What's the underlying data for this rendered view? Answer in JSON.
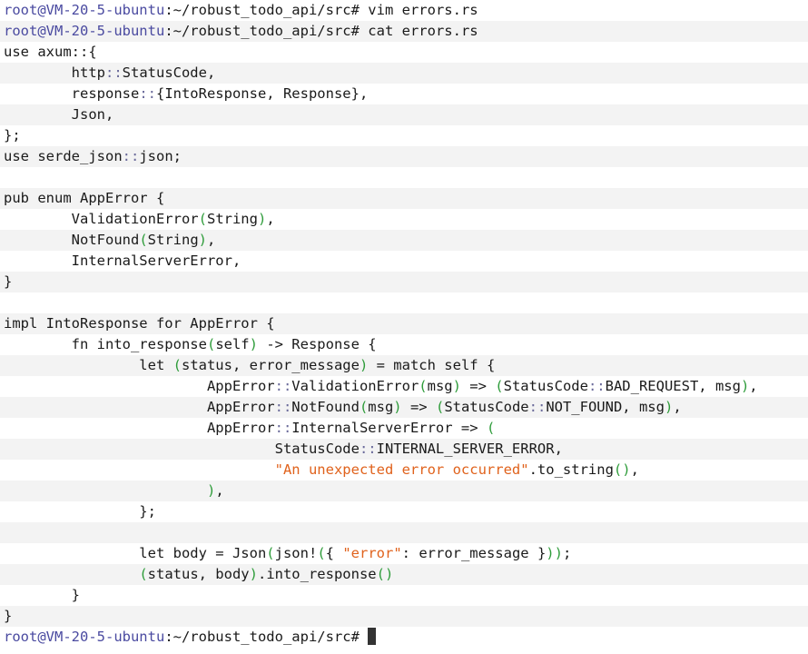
{
  "terminal": {
    "prompt": "root@VM-20-5-ubuntu",
    "cwd": ":~/robust_todo_api/src#",
    "commands": [
      "vim errors.rs",
      "cat errors.rs"
    ],
    "source_lines": [
      [
        {
          "t": "use axum::{",
          "c": "plain"
        }
      ],
      [
        {
          "t": "        http",
          "c": "plain"
        },
        {
          "t": "::",
          "c": "sym"
        },
        {
          "t": "StatusCode,",
          "c": "plain"
        }
      ],
      [
        {
          "t": "        response",
          "c": "plain"
        },
        {
          "t": "::",
          "c": "sym"
        },
        {
          "t": "{IntoResponse, Response},",
          "c": "plain"
        }
      ],
      [
        {
          "t": "        Json,",
          "c": "plain"
        }
      ],
      [
        {
          "t": "};",
          "c": "plain"
        }
      ],
      [
        {
          "t": "use serde_json",
          "c": "plain"
        },
        {
          "t": "::",
          "c": "sym"
        },
        {
          "t": "json;",
          "c": "plain"
        }
      ],
      [
        {
          "t": "",
          "c": "plain"
        }
      ],
      [
        {
          "t": "pub enum AppError {",
          "c": "plain"
        }
      ],
      [
        {
          "t": "        ValidationError",
          "c": "plain"
        },
        {
          "t": "(",
          "c": "paren"
        },
        {
          "t": "String",
          "c": "plain"
        },
        {
          "t": ")",
          "c": "paren"
        },
        {
          "t": ",",
          "c": "plain"
        }
      ],
      [
        {
          "t": "        NotFound",
          "c": "plain"
        },
        {
          "t": "(",
          "c": "paren"
        },
        {
          "t": "String",
          "c": "plain"
        },
        {
          "t": ")",
          "c": "paren"
        },
        {
          "t": ",",
          "c": "plain"
        }
      ],
      [
        {
          "t": "        InternalServerError,",
          "c": "plain"
        }
      ],
      [
        {
          "t": "}",
          "c": "plain"
        }
      ],
      [
        {
          "t": "",
          "c": "plain"
        }
      ],
      [
        {
          "t": "impl IntoResponse for AppError {",
          "c": "plain"
        }
      ],
      [
        {
          "t": "        fn into_response",
          "c": "plain"
        },
        {
          "t": "(",
          "c": "paren"
        },
        {
          "t": "self",
          "c": "plain"
        },
        {
          "t": ")",
          "c": "paren"
        },
        {
          "t": " -> Response {",
          "c": "plain"
        }
      ],
      [
        {
          "t": "                let ",
          "c": "plain"
        },
        {
          "t": "(",
          "c": "paren"
        },
        {
          "t": "status, error_message",
          "c": "plain"
        },
        {
          "t": ")",
          "c": "paren"
        },
        {
          "t": " = match self {",
          "c": "plain"
        }
      ],
      [
        {
          "t": "                        AppError",
          "c": "plain"
        },
        {
          "t": "::",
          "c": "sym"
        },
        {
          "t": "ValidationError",
          "c": "plain"
        },
        {
          "t": "(",
          "c": "paren"
        },
        {
          "t": "msg",
          "c": "plain"
        },
        {
          "t": ")",
          "c": "paren"
        },
        {
          "t": " => ",
          "c": "plain"
        },
        {
          "t": "(",
          "c": "paren"
        },
        {
          "t": "StatusCode",
          "c": "plain"
        },
        {
          "t": "::",
          "c": "sym"
        },
        {
          "t": "BAD_REQUEST, msg",
          "c": "plain"
        },
        {
          "t": ")",
          "c": "paren"
        },
        {
          "t": ",",
          "c": "plain"
        }
      ],
      [
        {
          "t": "                        AppError",
          "c": "plain"
        },
        {
          "t": "::",
          "c": "sym"
        },
        {
          "t": "NotFound",
          "c": "plain"
        },
        {
          "t": "(",
          "c": "paren"
        },
        {
          "t": "msg",
          "c": "plain"
        },
        {
          "t": ")",
          "c": "paren"
        },
        {
          "t": " => ",
          "c": "plain"
        },
        {
          "t": "(",
          "c": "paren"
        },
        {
          "t": "StatusCode",
          "c": "plain"
        },
        {
          "t": "::",
          "c": "sym"
        },
        {
          "t": "NOT_FOUND, msg",
          "c": "plain"
        },
        {
          "t": ")",
          "c": "paren"
        },
        {
          "t": ",",
          "c": "plain"
        }
      ],
      [
        {
          "t": "                        AppError",
          "c": "plain"
        },
        {
          "t": "::",
          "c": "sym"
        },
        {
          "t": "InternalServerError => ",
          "c": "plain"
        },
        {
          "t": "(",
          "c": "paren"
        }
      ],
      [
        {
          "t": "                                StatusCode",
          "c": "plain"
        },
        {
          "t": "::",
          "c": "sym"
        },
        {
          "t": "INTERNAL_SERVER_ERROR,",
          "c": "plain"
        }
      ],
      [
        {
          "t": "                                ",
          "c": "plain"
        },
        {
          "t": "\"An unexpected error occurred\"",
          "c": "str"
        },
        {
          "t": ".to_string",
          "c": "plain"
        },
        {
          "t": "()",
          "c": "paren"
        },
        {
          "t": ",",
          "c": "plain"
        }
      ],
      [
        {
          "t": "                        ",
          "c": "plain"
        },
        {
          "t": ")",
          "c": "paren"
        },
        {
          "t": ",",
          "c": "plain"
        }
      ],
      [
        {
          "t": "                };",
          "c": "plain"
        }
      ],
      [
        {
          "t": "",
          "c": "plain"
        }
      ],
      [
        {
          "t": "                let body = Json",
          "c": "plain"
        },
        {
          "t": "(",
          "c": "paren"
        },
        {
          "t": "json!",
          "c": "plain"
        },
        {
          "t": "(",
          "c": "paren"
        },
        {
          "t": "{ ",
          "c": "plain"
        },
        {
          "t": "\"error\"",
          "c": "str"
        },
        {
          "t": ": error_message }",
          "c": "plain"
        },
        {
          "t": "))",
          "c": "paren"
        },
        {
          "t": ";",
          "c": "plain"
        }
      ],
      [
        {
          "t": "                ",
          "c": "plain"
        },
        {
          "t": "(",
          "c": "paren"
        },
        {
          "t": "status, body",
          "c": "plain"
        },
        {
          "t": ")",
          "c": "paren"
        },
        {
          "t": ".into_response",
          "c": "plain"
        },
        {
          "t": "()",
          "c": "paren"
        }
      ],
      [
        {
          "t": "        }",
          "c": "plain"
        }
      ],
      [
        {
          "t": "}",
          "c": "plain"
        }
      ]
    ]
  },
  "colors": {
    "prompt": "#4a4aa0",
    "paren": "#2e9c3a",
    "string": "#e0621c",
    "stripe": "#f3f3f3"
  }
}
